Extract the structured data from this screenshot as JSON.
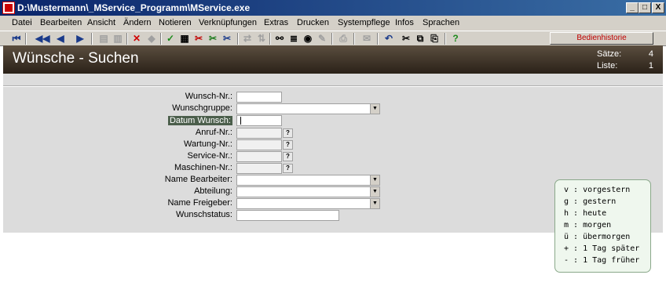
{
  "window": {
    "title": "D:\\Mustermann\\_MService_Programm\\MService.exe",
    "minimize": "_",
    "maximize": "□",
    "close": "X"
  },
  "menu": [
    "Datei",
    "Bearbeiten",
    "Ansicht",
    "Ändern",
    "Notieren",
    "Verknüpfungen",
    "Extras",
    "Drucken",
    "Systempflege",
    "Infos",
    "Sprachen"
  ],
  "toolbar": {
    "icons": [
      "first-record-icon",
      "previous-page-icon",
      "previous-icon",
      "next-icon",
      "export-icon",
      "import-icon",
      "delete-icon",
      "clear-icon",
      "confirm-icon",
      "calculator-icon",
      "tool-red-icon",
      "tool-green-icon",
      "tool-blue-icon",
      "link-icon",
      "sort-icon",
      "binoculars-icon",
      "list-icon",
      "view-icon",
      "notes-icon",
      "print-icon",
      "mail-icon",
      "undo-icon",
      "cut-icon",
      "copy-icon",
      "paste-icon",
      "help-icon"
    ],
    "history_label": "Bedienhistorie"
  },
  "header": {
    "title": "Wünsche - Suchen",
    "records_label": "Sätze:",
    "records_value": "4",
    "list_label": "Liste:",
    "list_value": "1"
  },
  "form": {
    "wunsch_nr": "Wunsch-Nr.:",
    "wunschgruppe": "Wunschgruppe:",
    "datum_wunsch": "Datum Wunsch:",
    "anruf_nr": "Anruf-Nr.:",
    "wartung_nr": "Wartung-Nr.:",
    "service_nr": "Service-Nr.:",
    "maschinen_nr": "Maschinen-Nr.:",
    "name_bearbeiter": "Name Bearbeiter:",
    "abteilung": "Abteilung:",
    "name_freigeber": "Name Freigeber:",
    "wunschstatus": "Wunschstatus:",
    "question_button": "?",
    "dropdown_arrow": "▼"
  },
  "date_hints": [
    "v : vorgestern",
    "g : gestern",
    "h : heute",
    "m : morgen",
    "ü : übermorgen",
    "+ : 1 Tag später",
    "- : 1 Tag früher"
  ]
}
